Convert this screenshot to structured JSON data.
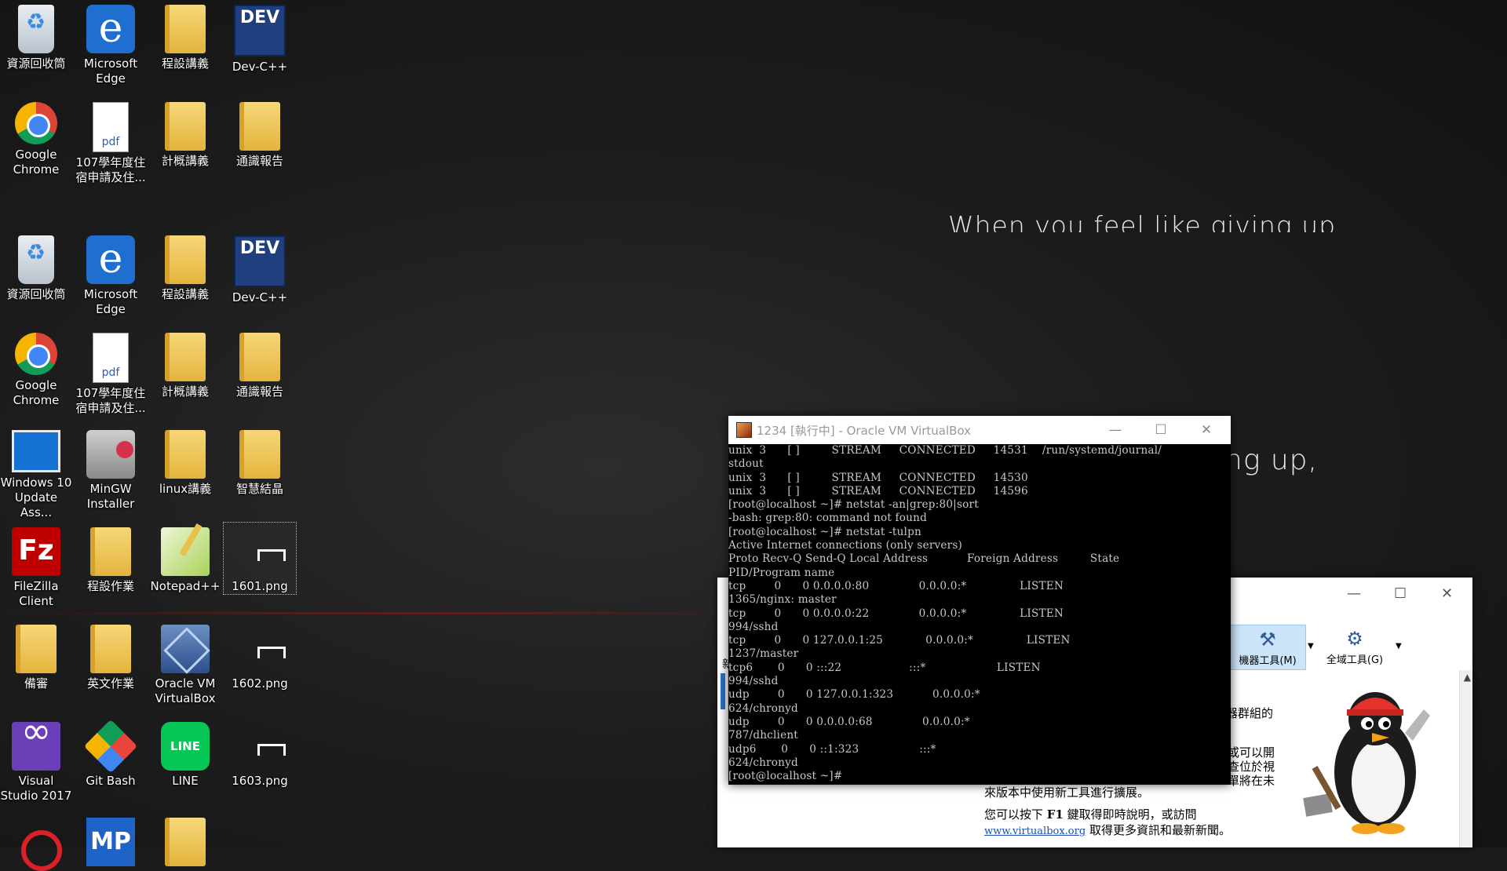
{
  "wallpaper": {
    "quote_top": "When you feel like giving up",
    "quote_right": "ng up,"
  },
  "desktop": {
    "icons_top": [
      {
        "label": "資源回收筒",
        "icon": "recycle-bin-icon"
      },
      {
        "label": "Microsoft Edge",
        "icon": "edge-icon"
      },
      {
        "label": "程設講義",
        "icon": "folder-icon"
      },
      {
        "label": "Dev-C++",
        "icon": "devcpp-icon"
      },
      {
        "label": "Google Chrome",
        "icon": "chrome-icon"
      },
      {
        "label": "107學年度住宿申請及住...",
        "icon": "pdf-icon"
      },
      {
        "label": "計概講義",
        "icon": "folder-icon"
      },
      {
        "label": "通識報告",
        "icon": "folder-icon"
      }
    ],
    "icons": [
      {
        "label": "資源回收筒",
        "icon": "recycle-bin-icon"
      },
      {
        "label": "Microsoft Edge",
        "icon": "edge-icon"
      },
      {
        "label": "程設講義",
        "icon": "folder-icon"
      },
      {
        "label": "Dev-C++",
        "icon": "devcpp-icon"
      },
      {
        "label": "Google Chrome",
        "icon": "chrome-icon"
      },
      {
        "label": "107學年度住宿申請及住...",
        "icon": "pdf-icon"
      },
      {
        "label": "計概講義",
        "icon": "folder-icon"
      },
      {
        "label": "通識報告",
        "icon": "folder-icon"
      },
      {
        "label": "Windows 10 Update Ass...",
        "icon": "windows-update-icon"
      },
      {
        "label": "MinGW Installer",
        "icon": "mingw-icon"
      },
      {
        "label": "linux講義",
        "icon": "folder-icon"
      },
      {
        "label": "智慧結晶",
        "icon": "folder-icon"
      },
      {
        "label": "FileZilla Client",
        "icon": "filezilla-icon"
      },
      {
        "label": "程設作業",
        "icon": "folder-icon"
      },
      {
        "label": "Notepad++",
        "icon": "notepadpp-icon"
      },
      {
        "label": "1601.png",
        "icon": "image-file-icon"
      },
      {
        "label": "備審",
        "icon": "folder-icon"
      },
      {
        "label": "英文作業",
        "icon": "folder-icon"
      },
      {
        "label": "Oracle VM VirtualBox",
        "icon": "virtualbox-icon"
      },
      {
        "label": "1602.png",
        "icon": "image-file-icon"
      },
      {
        "label": "Visual Studio 2017",
        "icon": "visual-studio-icon"
      },
      {
        "label": "Git Bash",
        "icon": "git-bash-icon"
      },
      {
        "label": "LINE",
        "icon": "line-icon"
      },
      {
        "label": "1603.png",
        "icon": "image-file-icon"
      }
    ],
    "icons_bottom": [
      {
        "icon": "garena-icon"
      },
      {
        "label_glyph": "MP",
        "icon": "mp-icon"
      },
      {
        "icon": "folder-icon"
      }
    ]
  },
  "console": {
    "title": "1234 [執行中] - Oracle VM VirtualBox",
    "lines": [
      "unix  3      [ ]         STREAM     CONNECTED     14531    /run/systemd/journal/",
      "stdout",
      "unix  3      [ ]         STREAM     CONNECTED     14530",
      "unix  3      [ ]         STREAM     CONNECTED     14596",
      "[root@localhost ~]# netstat -an|grep:80|sort",
      "-bash: grep:80: command not found",
      "[root@localhost ~]# netstat -tulpn",
      "Active Internet connections (only servers)",
      "Proto Recv-Q Send-Q Local Address           Foreign Address         State",
      "PID/Program name",
      "tcp        0      0 0.0.0.0:80              0.0.0.0:*               LISTEN",
      "1365/nginx: master",
      "tcp        0      0 0.0.0.0:22              0.0.0.0:*               LISTEN",
      "994/sshd",
      "tcp        0      0 127.0.0.1:25            0.0.0.0:*               LISTEN",
      "1237/master",
      "tcp6       0      0 :::22                   :::*                    LISTEN",
      "994/sshd",
      "udp        0      0 127.0.0.1:323           0.0.0.0:*",
      "624/chronyd",
      "udp        0      0 0.0.0.0:68              0.0.0.0:*",
      "787/dhclient",
      "udp6       0      0 ::1:323                 :::*",
      "624/chronyd",
      "[root@localhost ~]#"
    ]
  },
  "manager": {
    "tool_machine": "機器工具(M)",
    "tool_global": "全域工具(G)",
    "frag_1": "器群組的",
    "frag_2": "或可以開",
    "frag_3": "查位於視",
    "frag_4": "單將在未",
    "left_fragment": "新",
    "welcome_line1": "來版本中使用新工具進行擴展。",
    "welcome_line2_pre": "您可以按下 ",
    "welcome_key": "F1",
    "welcome_line2_post": " 鍵取得即時說明，或訪問",
    "welcome_link": "www.virtualbox.org",
    "welcome_line3_post": " 取得更多資訊和最新新聞。"
  },
  "window_controls": {
    "minimize": "—",
    "maximize": "☐",
    "close": "✕"
  }
}
